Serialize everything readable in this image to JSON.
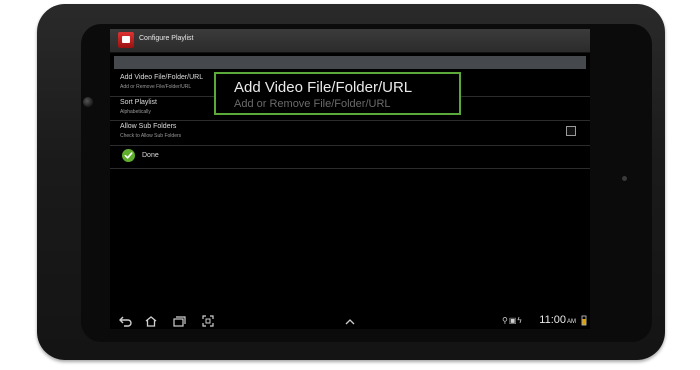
{
  "app": {
    "title": "Configure Playlist"
  },
  "menu": {
    "items": [
      {
        "label": "Add Video File/Folder/URL",
        "sub": "Add or Remove File/Folder/URL"
      },
      {
        "label": "Sort Playlist",
        "sub": "Alphabetically"
      },
      {
        "label": "Allow Sub Folders",
        "sub": "Check to Allow Sub Folders",
        "checked": false
      },
      {
        "label": "Done"
      }
    ]
  },
  "tooltip": {
    "title": "Add Video File/Folder/URL",
    "sub": "Add or Remove File/Folder/URL"
  },
  "statusbar": {
    "time": "11:00",
    "ampm": "AM"
  },
  "colors": {
    "highlight": "#5ba83b",
    "done_icon": "#5fae2e"
  }
}
